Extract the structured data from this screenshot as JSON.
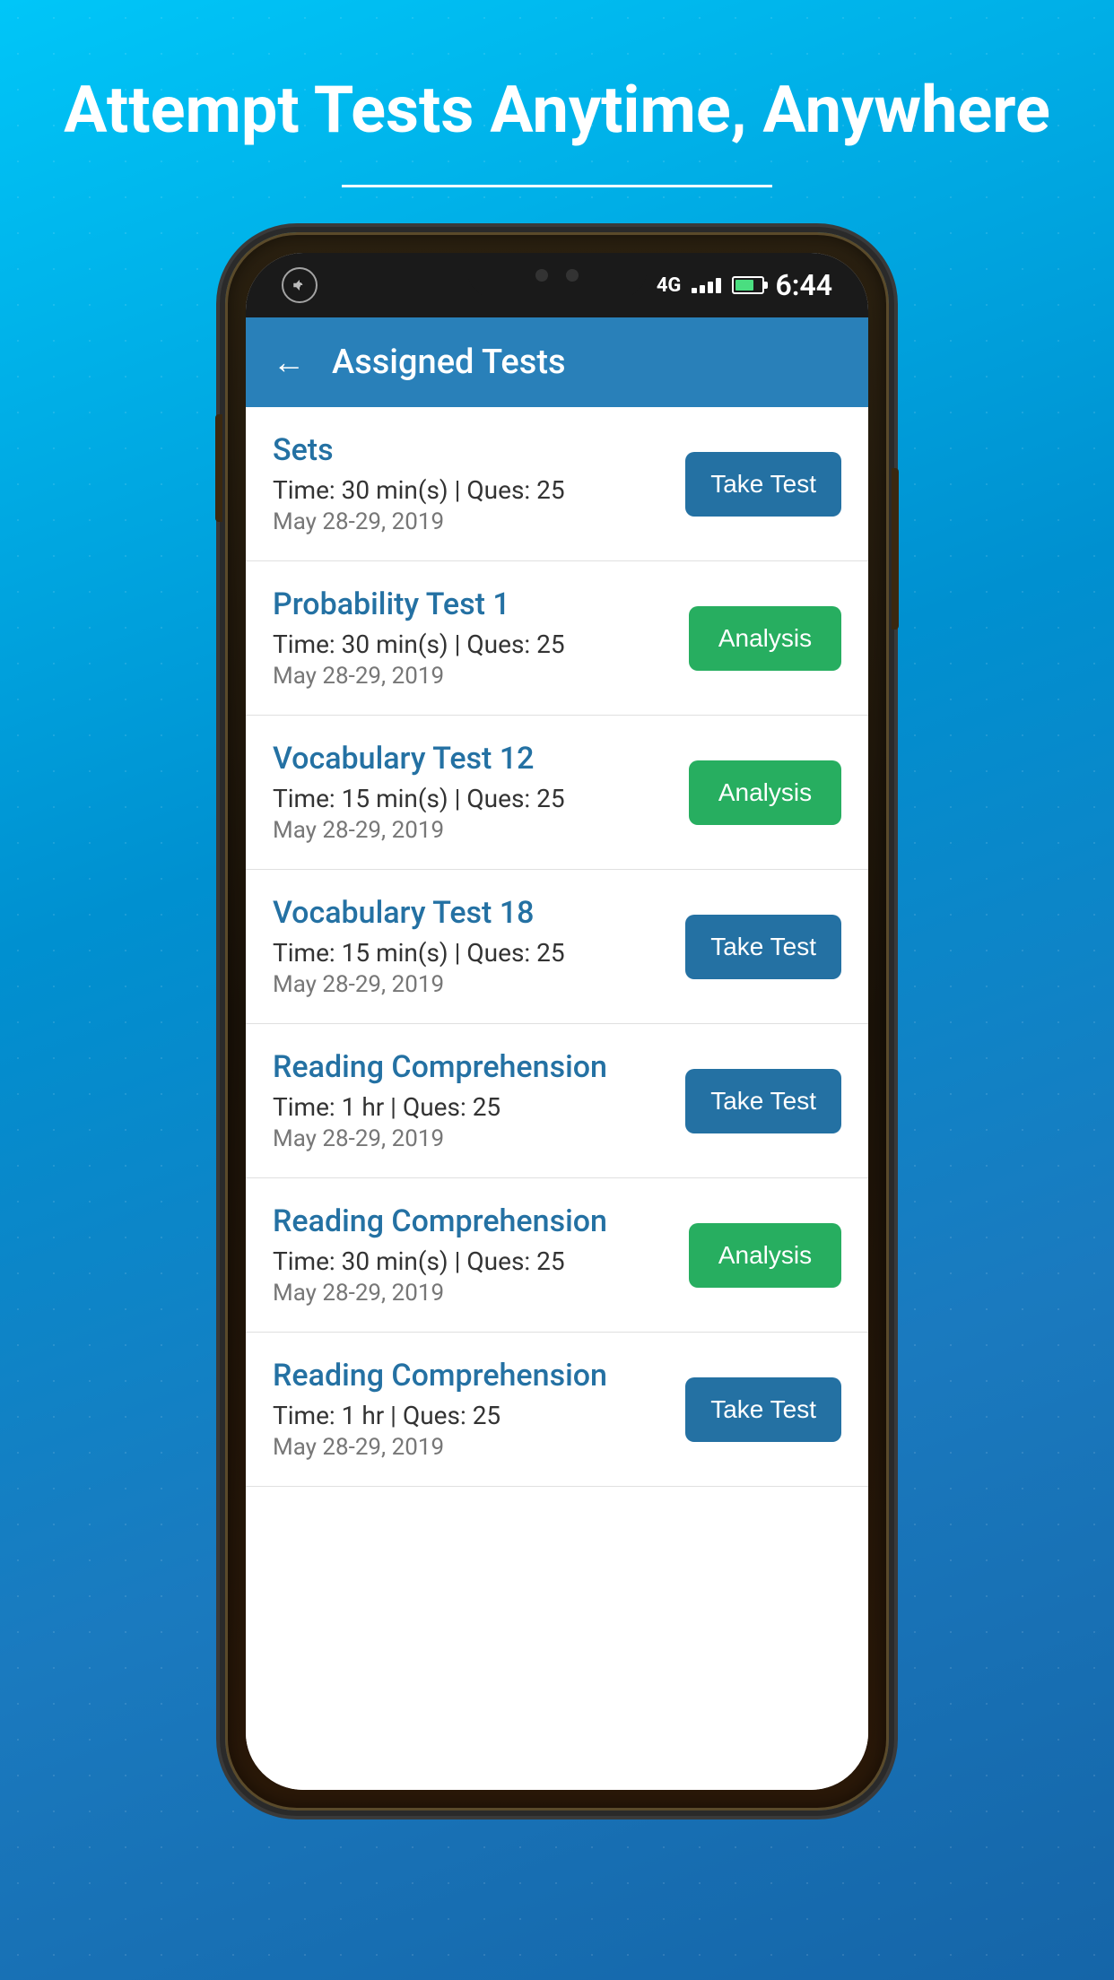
{
  "hero": {
    "title": "Attempt Tests Anytime, Anywhere"
  },
  "status_bar": {
    "time": "6:44",
    "network": "4G",
    "signal_bars": [
      4,
      6,
      8,
      10,
      12
    ],
    "battery_level": 70
  },
  "app_header": {
    "back_label": "←",
    "title": "Assigned Tests"
  },
  "tests": [
    {
      "name": "Sets",
      "meta": "Time: 30 min(s) | Ques: 25",
      "date": "May 28-29, 2019",
      "button_type": "take_test",
      "button_label": "Take Test"
    },
    {
      "name": "Probability Test 1",
      "meta": "Time: 30 min(s) | Ques: 25",
      "date": "May 28-29, 2019",
      "button_type": "analysis",
      "button_label": "Analysis"
    },
    {
      "name": "Vocabulary Test 12",
      "meta": "Time: 15 min(s) | Ques: 25",
      "date": "May 28-29, 2019",
      "button_type": "analysis",
      "button_label": "Analysis"
    },
    {
      "name": "Vocabulary Test 18",
      "meta": "Time: 15 min(s) | Ques: 25",
      "date": "May 28-29, 2019",
      "button_type": "take_test",
      "button_label": "Take Test"
    },
    {
      "name": "Reading Comprehension",
      "meta": "Time: 1 hr | Ques: 25",
      "date": "May 28-29, 2019",
      "button_type": "take_test",
      "button_label": "Take Test"
    },
    {
      "name": "Reading Comprehension",
      "meta": "Time: 30 min(s) | Ques: 25",
      "date": "May 28-29, 2019",
      "button_type": "analysis",
      "button_label": "Analysis"
    },
    {
      "name": "Reading Comprehension",
      "meta": "Time: 1 hr | Ques: 25",
      "date": "May 28-29, 2019",
      "button_type": "take_test",
      "button_label": "Take Test"
    }
  ]
}
